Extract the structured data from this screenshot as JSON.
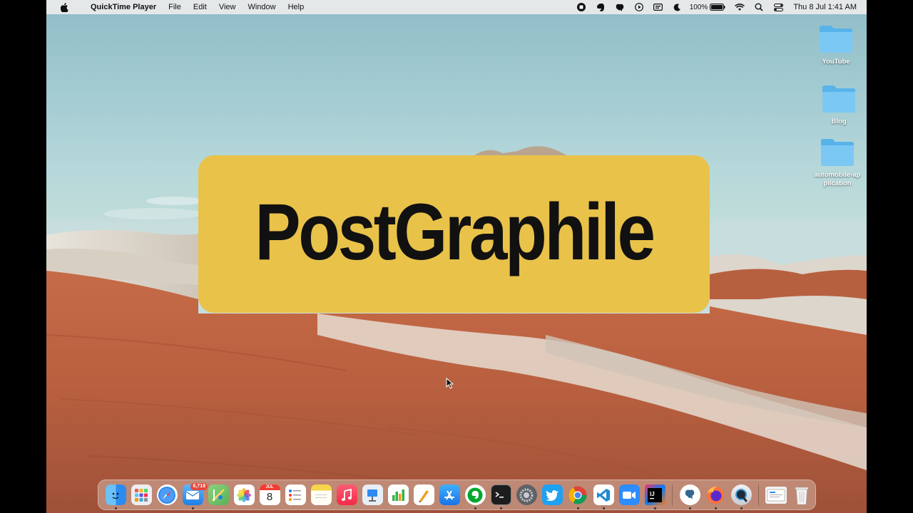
{
  "menubar": {
    "app_name": "QuickTime Player",
    "menus": [
      "File",
      "Edit",
      "View",
      "Window",
      "Help"
    ],
    "battery": "100%",
    "clock": "Thu 8 Jul  1:41 AM"
  },
  "desktop": {
    "folders": [
      "YouTube",
      "Blog",
      "automobile-application"
    ]
  },
  "banner": {
    "title": "PostGraphile",
    "background": "#e9c24a"
  },
  "dock": {
    "mail_badge": "6,719",
    "calendar_month": "JUL",
    "calendar_day": "8",
    "apps": [
      {
        "name": "finder-icon",
        "color": "#2b8cf0",
        "running": true
      },
      {
        "name": "launchpad-icon",
        "color": "#e9e9ec",
        "running": false
      },
      {
        "name": "safari-icon",
        "color": "#1e88e5",
        "running": false
      },
      {
        "name": "mail-icon",
        "color": "#3b9df3",
        "running": true
      },
      {
        "name": "maps-icon",
        "color": "#6fc16a",
        "running": false
      },
      {
        "name": "photos-icon",
        "color": "#ffffff",
        "running": false
      },
      {
        "name": "calendar-icon",
        "color": "#ffffff",
        "running": false
      },
      {
        "name": "reminders-icon",
        "color": "#ffffff",
        "running": false
      },
      {
        "name": "notes-icon",
        "color": "#f7d54a",
        "running": false
      },
      {
        "name": "music-icon",
        "color": "#f4374f",
        "running": false
      },
      {
        "name": "keynote-icon",
        "color": "#e8eef5",
        "running": false
      },
      {
        "name": "numbers-icon",
        "color": "#ffffff",
        "running": false
      },
      {
        "name": "pages-icon",
        "color": "#ffffff",
        "running": false
      },
      {
        "name": "app-store-icon",
        "color": "#2b8cf0",
        "running": false
      },
      {
        "name": "evernote-icon",
        "color": "#ffffff",
        "running": true
      },
      {
        "name": "terminal-icon",
        "color": "#1d1d1d",
        "running": true
      },
      {
        "name": "system-preferences-icon",
        "color": "#7d8186",
        "running": false
      },
      {
        "name": "twitter-icon",
        "color": "#1da1f2",
        "running": false
      },
      {
        "name": "chrome-icon",
        "color": "#ffffff",
        "running": true
      },
      {
        "name": "vscode-icon",
        "color": "#ffffff",
        "running": true
      },
      {
        "name": "zoom-icon",
        "color": "#2d8cff",
        "running": false
      },
      {
        "name": "intellij-icon",
        "color": "#111111",
        "running": true
      },
      {
        "name": "postgres-icon",
        "color": "#ffffff",
        "running": true
      },
      {
        "name": "firefox-icon",
        "color": "#ff7139",
        "running": true
      },
      {
        "name": "quicktime-icon",
        "color": "#dfe3e8",
        "running": true
      },
      {
        "name": "downloads-stack-icon",
        "color": "#f2f2f2",
        "running": false
      },
      {
        "name": "trash-icon",
        "color": "#e6e6e6",
        "running": false
      }
    ]
  }
}
